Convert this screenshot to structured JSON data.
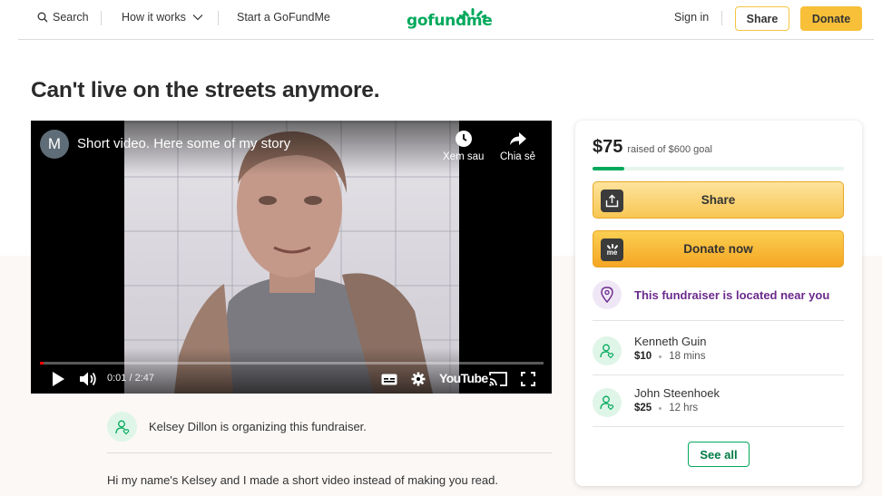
{
  "header": {
    "search_label": "Search",
    "how_it_works_label": "How it works",
    "start_label": "Start a GoFundMe",
    "logo_text": "gofundme",
    "signin_label": "Sign in",
    "share_label": "Share",
    "donate_label": "Donate",
    "brand_color": "#02a95c",
    "accent_color": "#f7c038"
  },
  "title": "Can't live on the streets anymore.",
  "video": {
    "channel_initial": "M",
    "title": "Short video. Here some of my story",
    "watch_later_label": "Xem sau",
    "share_label": "Chia sẻ",
    "time": "0:01 / 2:47",
    "youtube_label": "YouTube",
    "progress_fraction": 0.006
  },
  "organizer": {
    "text": "Kelsey Dillon is organizing this fundraiser."
  },
  "story": {
    "text": "Hi my name's Kelsey and I made a short video instead of making you read."
  },
  "panel": {
    "raised_amount": "$75",
    "raised_goal_text": "raised of $600 goal",
    "progress_fraction": 0.125,
    "share_label": "Share",
    "donate_label": "Donate now",
    "donate_icon_text": "me",
    "near_text": "This fundraiser is located near you",
    "donors": [
      {
        "name": "Kenneth Guin",
        "amount": "$10",
        "time": "18 mins"
      },
      {
        "name": "John Steenhoek",
        "amount": "$25",
        "time": "12 hrs"
      }
    ],
    "see_all_label": "See all"
  }
}
